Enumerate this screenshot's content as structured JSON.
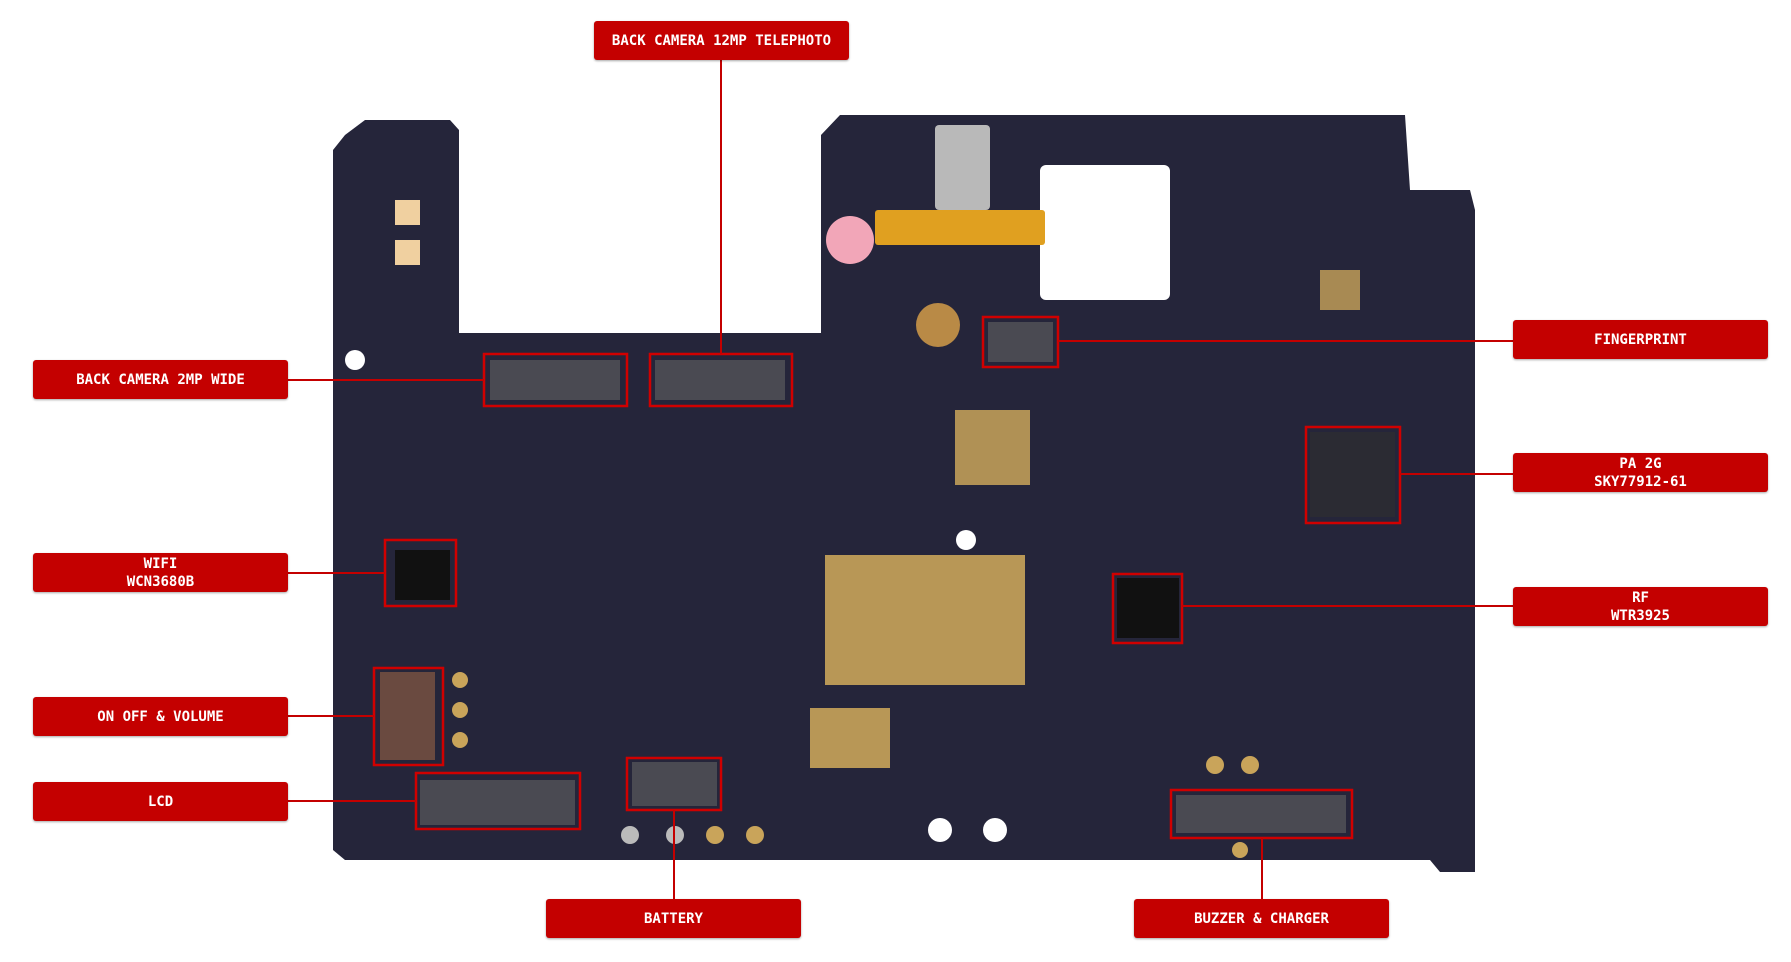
{
  "colors": {
    "label_bg": "#c40000",
    "label_text": "#ffffff",
    "board": "#25253a",
    "highlight": "#d00000",
    "pad_gold": "#c9a45a"
  },
  "labels": {
    "back_camera_telephoto": "BACK CAMERA 12MP TELEPHOTO",
    "back_camera_wide": "BACK CAMERA 2MP WIDE",
    "fingerprint": "FINGERPRINT",
    "pa_2g": {
      "line1": "PA 2G",
      "line2": "SKY77912-61"
    },
    "wifi": {
      "line1": "WIFI",
      "line2": "WCN3680B"
    },
    "rf": {
      "line1": "RF",
      "line2": "WTR3925"
    },
    "on_off_volume": "ON OFF & VOLUME",
    "lcd": "LCD",
    "battery": "BATTERY",
    "buzzer_charger": "BUZZER & CHARGER"
  }
}
